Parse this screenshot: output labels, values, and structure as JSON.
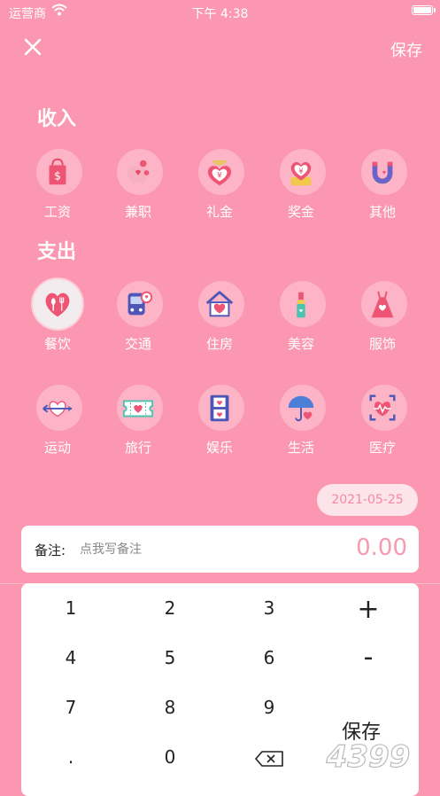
{
  "status_bar": {
    "carrier": "运营商",
    "time": "下午 4:38"
  },
  "header": {
    "save_label": "保存"
  },
  "income": {
    "title": "收入",
    "items": [
      {
        "label": "工资",
        "icon": "shopping-bag-icon"
      },
      {
        "label": "兼职",
        "icon": "piggy-bank-icon"
      },
      {
        "label": "礼金",
        "icon": "money-bag-icon"
      },
      {
        "label": "奖金",
        "icon": "heart-bonus-icon"
      },
      {
        "label": "其他",
        "icon": "magnet-icon"
      }
    ]
  },
  "expense": {
    "title": "支出",
    "items": [
      {
        "label": "餐饮",
        "icon": "dining-icon",
        "selected": true
      },
      {
        "label": "交通",
        "icon": "bus-icon"
      },
      {
        "label": "住房",
        "icon": "house-icon"
      },
      {
        "label": "美容",
        "icon": "lipstick-icon"
      },
      {
        "label": "服饰",
        "icon": "dress-icon"
      },
      {
        "label": "运动",
        "icon": "arrow-heart-icon"
      },
      {
        "label": "旅行",
        "icon": "ticket-icon"
      },
      {
        "label": "娱乐",
        "icon": "film-icon"
      },
      {
        "label": "生活",
        "icon": "umbrella-icon"
      },
      {
        "label": "医疗",
        "icon": "heartbeat-icon"
      }
    ]
  },
  "date": "2021-05-25",
  "note": {
    "label": "备注:",
    "placeholder": "点我写备注",
    "amount": "0.00"
  },
  "keypad": {
    "k1": "1",
    "k2": "2",
    "k3": "3",
    "plus": "+",
    "k4": "4",
    "k5": "5",
    "k6": "6",
    "minus": "-",
    "k7": "7",
    "k8": "8",
    "k9": "9",
    "dot": ".",
    "k0": "0",
    "save": "保存"
  },
  "watermark": "4399"
}
